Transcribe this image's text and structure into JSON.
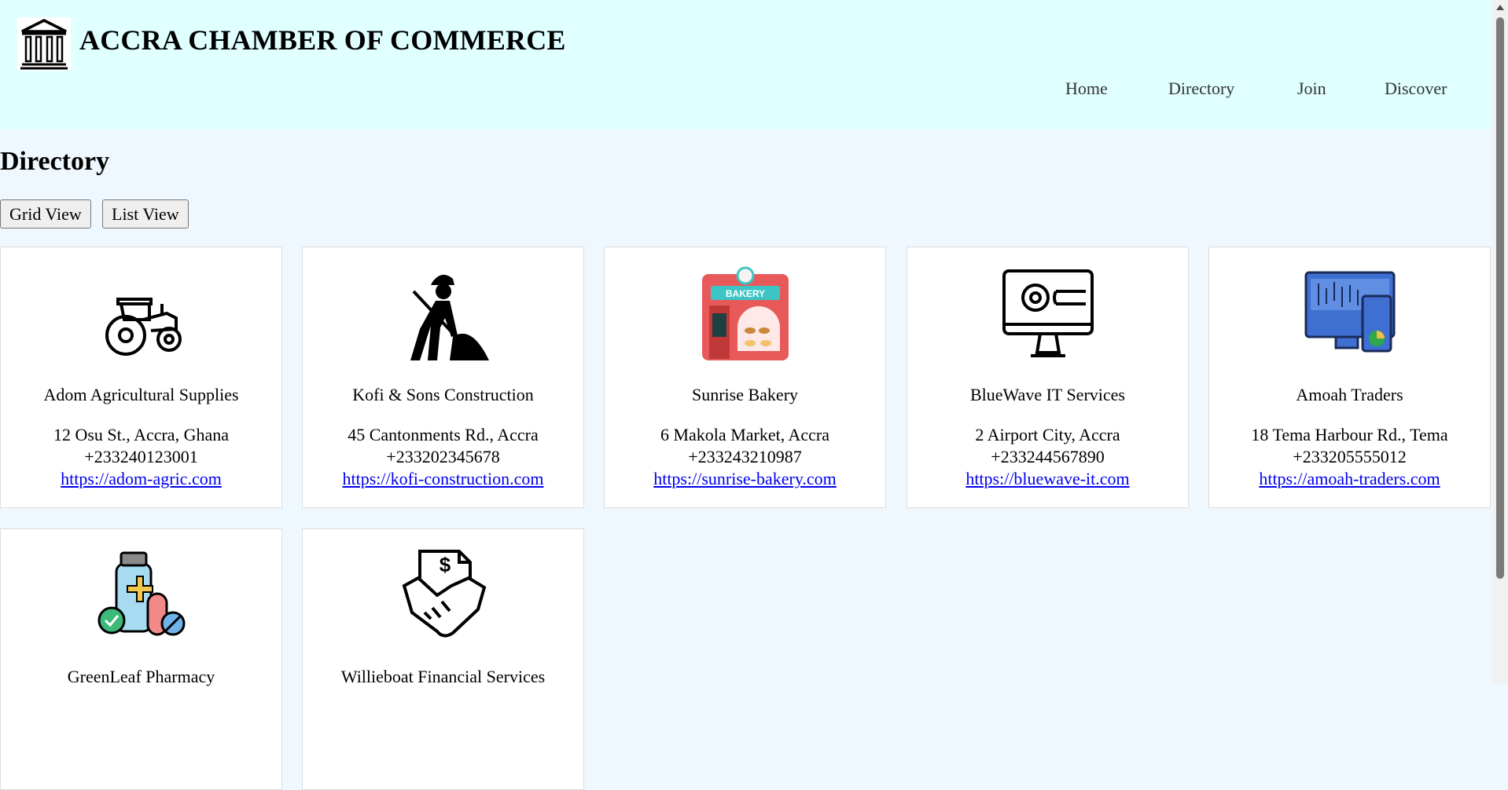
{
  "header": {
    "title": "ACCRA CHAMBER OF COMMERCE",
    "nav": [
      "Home",
      "Directory",
      "Join",
      "Discover"
    ]
  },
  "main": {
    "title": "Directory",
    "grid_view_label": "Grid View",
    "list_view_label": "List View"
  },
  "members": [
    {
      "name": "Adom Agricultural Supplies",
      "address": "12 Osu St., Accra, Ghana",
      "phone": "+233240123001",
      "website": "https://adom-agric.com",
      "icon": "tractor-icon"
    },
    {
      "name": "Kofi & Sons Construction",
      "address": "45 Cantonments Rd., Accra",
      "phone": "+233202345678",
      "website": "https://kofi-construction.com",
      "icon": "construction-worker-icon"
    },
    {
      "name": "Sunrise Bakery",
      "address": "6 Makola Market, Accra",
      "phone": "+233243210987",
      "website": "https://sunrise-bakery.com",
      "icon": "bakery-shop-icon"
    },
    {
      "name": "BlueWave IT Services",
      "address": "2 Airport City, Accra",
      "phone": "+233244567890",
      "website": "https://bluewave-it.com",
      "icon": "monitor-gear-icon"
    },
    {
      "name": "Amoah Traders",
      "address": "18 Tema Harbour Rd., Tema",
      "phone": "+233205555012",
      "website": "https://amoah-traders.com",
      "icon": "trading-dashboard-icon"
    },
    {
      "name": "GreenLeaf Pharmacy",
      "address": "",
      "phone": "",
      "website": "",
      "icon": "medicine-icon"
    },
    {
      "name": "Willieboat Financial Services",
      "address": "",
      "phone": "",
      "website": "",
      "icon": "handshake-dollar-icon"
    }
  ],
  "colors": {
    "header_bg": "#e0ffff",
    "page_bg": "#f0f8ff",
    "link": "#0000ee"
  }
}
